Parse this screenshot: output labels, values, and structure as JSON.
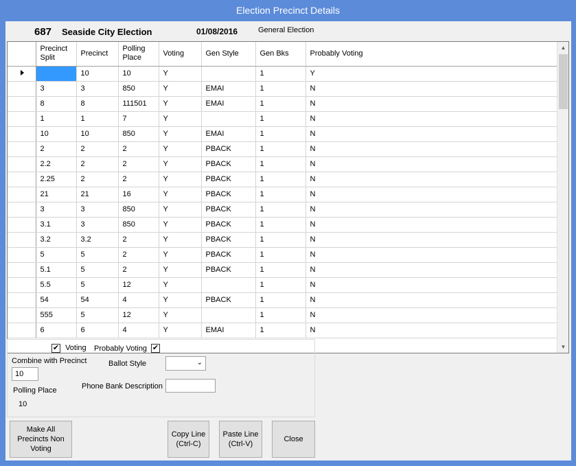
{
  "window": {
    "title": "Election Precinct Details"
  },
  "header": {
    "number": "687",
    "name": "Seaside City Election",
    "date": "01/08/2016",
    "type": "General Election"
  },
  "grid": {
    "columns": [
      "Precinct Split",
      "Precinct",
      "Polling Place",
      "Voting",
      "Gen Style",
      "Gen Bks",
      "Probably Voting"
    ],
    "rows": [
      [
        "",
        "10",
        "10",
        "Y",
        "",
        "1",
        "Y"
      ],
      [
        "3",
        "3",
        "850",
        "Y",
        "EMAI",
        "1",
        "N"
      ],
      [
        "8",
        "8",
        "111501",
        "Y",
        "EMAI",
        "1",
        "N"
      ],
      [
        "1",
        "1",
        "7",
        "Y",
        "",
        "1",
        "N"
      ],
      [
        "10",
        "10",
        "850",
        "Y",
        "EMAI",
        "1",
        "N"
      ],
      [
        "2",
        "2",
        "2",
        "Y",
        "PBACK",
        "1",
        "N"
      ],
      [
        "2.2",
        "2",
        "2",
        "Y",
        "PBACK",
        "1",
        "N"
      ],
      [
        "2.25",
        "2",
        "2",
        "Y",
        "PBACK",
        "1",
        "N"
      ],
      [
        "21",
        "21",
        "16",
        "Y",
        "PBACK",
        "1",
        "N"
      ],
      [
        "3",
        "3",
        "850",
        "Y",
        "PBACK",
        "1",
        "N"
      ],
      [
        "3.1",
        "3",
        "850",
        "Y",
        "PBACK",
        "1",
        "N"
      ],
      [
        "3.2",
        "3.2",
        "2",
        "Y",
        "PBACK",
        "1",
        "N"
      ],
      [
        "5",
        "5",
        "2",
        "Y",
        "PBACK",
        "1",
        "N"
      ],
      [
        "5.1",
        "5",
        "2",
        "Y",
        "PBACK",
        "1",
        "N"
      ],
      [
        "5.5",
        "5",
        "12",
        "Y",
        "",
        "1",
        "N"
      ],
      [
        "54",
        "54",
        "4",
        "Y",
        "PBACK",
        "1",
        "N"
      ],
      [
        "555",
        "5",
        "12",
        "Y",
        "",
        "1",
        "N"
      ],
      [
        "6",
        "6",
        "4",
        "Y",
        "EMAI",
        "1",
        "N"
      ]
    ]
  },
  "details": {
    "voting_label": "Voting",
    "voting_checked": true,
    "probably_voting_label": "Probably Voting",
    "probably_voting_checked": true,
    "combine_label": "Combine with Precinct",
    "combine_value": "10",
    "ballot_style_label": "Ballot Style",
    "ballot_style_value": "",
    "polling_place_label": "Polling Place",
    "polling_place_value": "10",
    "phone_bank_label": "Phone Bank Description",
    "phone_bank_value": ""
  },
  "buttons": {
    "make_all": "Make All Precincts Non Voting",
    "copy_line": "Copy Line (Ctrl-C)",
    "paste_line": "Paste Line (Ctrl-V)",
    "close": "Close"
  },
  "icons": {
    "row_indicator": "row-indicator-arrow-icon",
    "scroll_up": "scroll-up-arrow-icon",
    "scroll_down": "scroll-down-arrow-icon",
    "dropdown": "chevron-down-icon",
    "check": "checkmark-icon"
  },
  "colors": {
    "titlebar": "#5b8bd9",
    "selection": "#3399ff"
  }
}
